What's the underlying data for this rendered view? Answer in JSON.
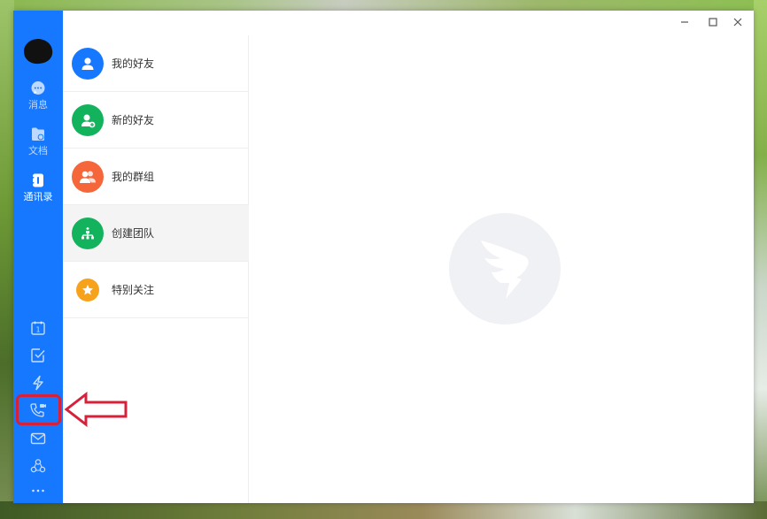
{
  "sidebar": {
    "nav": [
      {
        "label": "消息",
        "icon": "message-icon",
        "active": false
      },
      {
        "label": "文档",
        "icon": "document-icon",
        "active": false
      },
      {
        "label": "通讯录",
        "icon": "contacts-icon",
        "active": true
      }
    ],
    "tools": [
      {
        "icon": "calendar-icon",
        "calendar_day": "1"
      },
      {
        "icon": "todo-check-icon"
      },
      {
        "icon": "lightning-icon"
      },
      {
        "icon": "phone-meeting-icon"
      },
      {
        "icon": "mail-icon"
      },
      {
        "icon": "workplace-icon"
      }
    ],
    "more_icon": "more-dots-icon"
  },
  "contacts_list": [
    {
      "label": "我的好友",
      "icon": "person-icon",
      "color": "#1677ff"
    },
    {
      "label": "新的好友",
      "icon": "add-person-icon",
      "color": "#12b35c"
    },
    {
      "label": "我的群组",
      "icon": "group-icon",
      "color": "#f5673a"
    },
    {
      "label": "创建团队",
      "icon": "org-chart-icon",
      "color": "#12b35c",
      "hovered": true
    },
    {
      "label": "特别关注",
      "icon": "star-icon",
      "color": "#f7a21b"
    }
  ],
  "window_controls": [
    "minimize-icon",
    "maximize-icon",
    "close-icon"
  ],
  "empty_state_icon": "dingtalk-logo-icon",
  "annotation": {
    "color": "#d6213a"
  },
  "colors": {
    "sidebar": "#1677ff",
    "accent": "#1677ff"
  }
}
